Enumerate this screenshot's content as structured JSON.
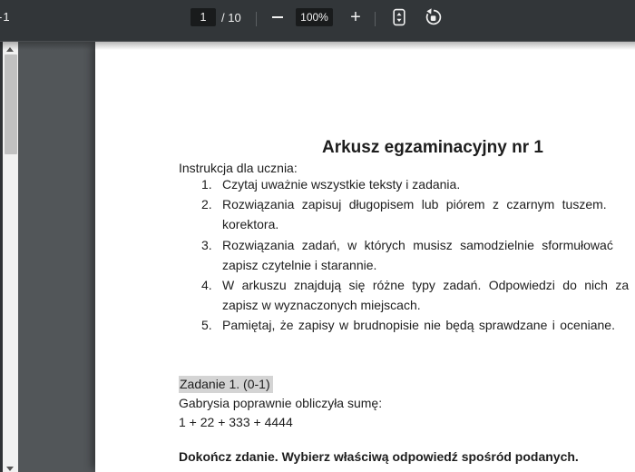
{
  "toolbar": {
    "title_fragment": "-1",
    "page_input_value": "1",
    "page_total": "/ 10",
    "zoom_level": "100%",
    "icons": {
      "zoom_out": "minus-icon",
      "zoom_in": "plus-icon",
      "fit": "fit-to-page-icon",
      "rotate": "rotate-counterclockwise-icon",
      "scroll_up": "up-arrow-icon",
      "scroll_down": "down-arrow-icon"
    },
    "zoom_in_glyph": "+"
  },
  "document": {
    "heading": "Arkusz egzaminacyjny nr 1",
    "intro_line": "Instrukcja dla ucznia:",
    "instructions": [
      {
        "num": "1.",
        "lines": [
          "Czytaj uważnie wszystkie teksty i zadania."
        ],
        "spacings": [
          "normal"
        ]
      },
      {
        "num": "2.",
        "lines": [
          "Rozwiązania zapisuj długopisem lub piórem z czarnym tuszem.",
          "korektora."
        ],
        "spacings": [
          "wide",
          "normal"
        ]
      },
      {
        "num": "3.",
        "lines": [
          "Rozwiązania zadań, w których musisz samodzielnie sformułować",
          "zapisz czytelnie i starannie."
        ],
        "spacings": [
          "wide",
          "normal"
        ]
      },
      {
        "num": "4.",
        "lines": [
          "W arkuszu znajdują się różne typy zadań. Odpowiedzi do nich za",
          "zapisz w wyznaczonych miejscach."
        ],
        "spacings": [
          "wide",
          "normal"
        ]
      },
      {
        "num": "5.",
        "lines": [
          "Pamiętaj, że zapisy w brudnopisie nie będą sprawdzane i oceniane."
        ],
        "spacings": [
          "slight"
        ]
      }
    ],
    "task_label": "Zadanie 1. (0-1)",
    "task_line_1": "Gabrysia poprawnie obliczyła sumę:",
    "task_line_2": "1 + 22 + 333 + 4444",
    "task_bold": "Dokończ zdanie. Wybierz właściwą odpowiedź spośród podanych."
  },
  "colors": {
    "toolbar_bg": "#323639",
    "viewer_bg": "#525659",
    "control_box_bg": "#191b1c",
    "toolbar_fg": "#f1f1f1",
    "scroll_track": "#f1f1f1",
    "scroll_thumb": "#c1c1c1",
    "selection_highlight": "#d4d4d4"
  }
}
